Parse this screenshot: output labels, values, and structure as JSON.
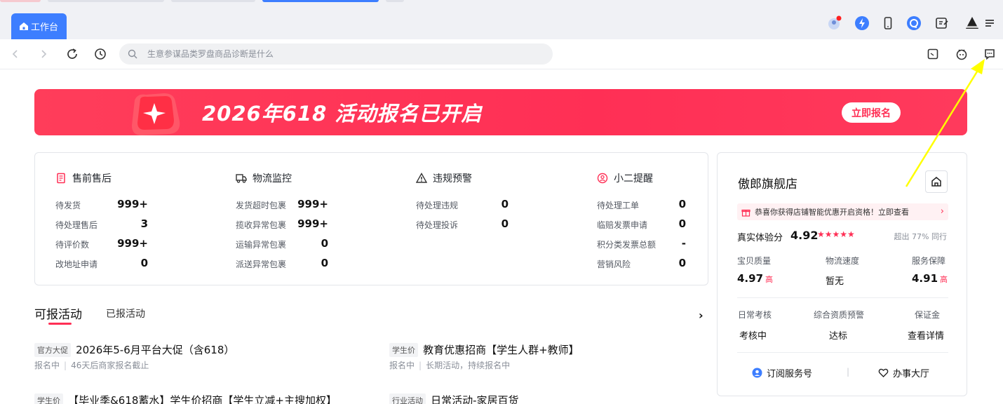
{
  "tabs": {
    "workbench_label": "工作台"
  },
  "address_bar": {
    "placeholder": "生意参谋品类罗盘商品诊断是什么"
  },
  "banner": {
    "title": "2026年618 活动报名已开启",
    "button_label": "立即报名"
  },
  "stats": [
    {
      "title": "售前售后",
      "icon": "document-icon",
      "rows": [
        {
          "label": "待发货",
          "value": "999+"
        },
        {
          "label": "待处理售后",
          "value": "3"
        },
        {
          "label": "待评价数",
          "value": "999+"
        },
        {
          "label": "改地址申请",
          "value": "0"
        }
      ]
    },
    {
      "title": "物流监控",
      "icon": "truck-icon",
      "rows": [
        {
          "label": "发货超时包裹",
          "value": "999+"
        },
        {
          "label": "揽收异常包裹",
          "value": "999+"
        },
        {
          "label": "运输异常包裹",
          "value": "0"
        },
        {
          "label": "派送异常包裹",
          "value": "0"
        }
      ]
    },
    {
      "title": "违规预警",
      "icon": "warning-icon",
      "rows": [
        {
          "label": "待处理违规",
          "value": "0"
        },
        {
          "label": "待处理投诉",
          "value": "0"
        }
      ]
    },
    {
      "title": "小二提醒",
      "icon": "assistant-icon",
      "rows": [
        {
          "label": "待处理工单",
          "value": "0"
        },
        {
          "label": "临赔发票申请",
          "value": "0"
        },
        {
          "label": "积分类发票总额",
          "value": "-"
        },
        {
          "label": "营销风险",
          "value": "0"
        }
      ]
    }
  ],
  "activities": {
    "tab_available": "可报活动",
    "tab_registered": "已报活动",
    "more": "›",
    "items": [
      {
        "tag": "官方大促",
        "title": "2026年5-6月平台大促（含618）",
        "status": "报名中",
        "note": "46天后商家报名截止"
      },
      {
        "tag": "学生价",
        "title": "教育优惠招商【学生人群+教师】",
        "status": "报名中",
        "note": "长期活动，持续报名中"
      },
      {
        "tag": "学生价",
        "title": "【毕业季&618蓄水】学生价招商【学生立减+主搜加权】",
        "status": "",
        "note": ""
      },
      {
        "tag": "行业活动",
        "title": "日常活动-家居百货",
        "status": "",
        "note": ""
      }
    ]
  },
  "shop": {
    "name": "傲郎旗舰店",
    "promo": "恭喜你获得店铺智能优惠开启资格！立即查看",
    "score_label": "真实体验分",
    "score_value": "4.92",
    "stars": "★★★★★",
    "score_compare": "超出 77% 同行",
    "metrics": [
      {
        "label": "宝贝质量",
        "value": "4.97",
        "tag": "高"
      },
      {
        "label": "物流速度",
        "value": "暂无",
        "tag": ""
      },
      {
        "label": "服务保障",
        "value": "4.91",
        "tag": "高"
      }
    ],
    "checks": [
      {
        "label": "日常考核",
        "value": "考核中"
      },
      {
        "label": "综合资质预警",
        "value": "达标"
      },
      {
        "label": "保证金",
        "value": "查看详情"
      }
    ],
    "footer": {
      "subscribe": "订阅服务号",
      "service_hall": "办事大厅",
      "separator": "|"
    }
  },
  "colors": {
    "accent": "#ff2f55",
    "primary": "#3d7eff",
    "annotation_arrow": "#ffff00"
  }
}
